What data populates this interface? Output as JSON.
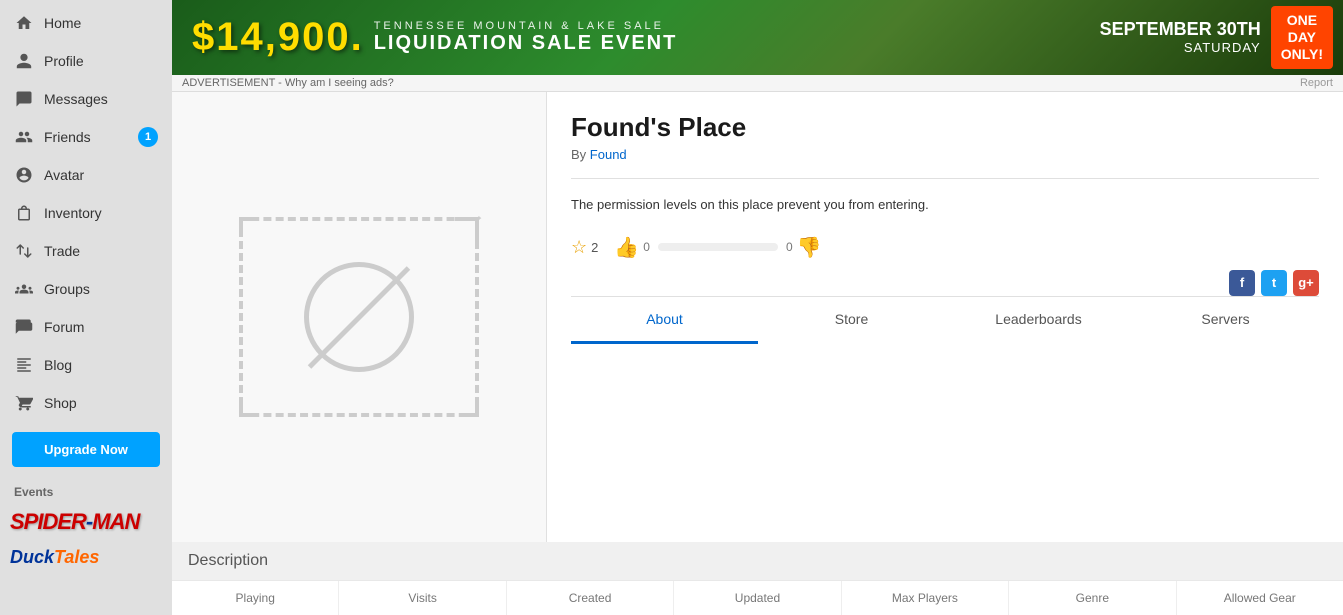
{
  "sidebar": {
    "nav_items": [
      {
        "id": "home",
        "label": "Home",
        "icon": "home"
      },
      {
        "id": "profile",
        "label": "Profile",
        "icon": "person"
      },
      {
        "id": "messages",
        "label": "Messages",
        "icon": "message"
      },
      {
        "id": "friends",
        "label": "Friends",
        "icon": "friends",
        "badge": "1"
      },
      {
        "id": "avatar",
        "label": "Avatar",
        "icon": "avatar"
      },
      {
        "id": "inventory",
        "label": "Inventory",
        "icon": "bag"
      },
      {
        "id": "trade",
        "label": "Trade",
        "icon": "trade"
      },
      {
        "id": "groups",
        "label": "Groups",
        "icon": "groups"
      },
      {
        "id": "forum",
        "label": "Forum",
        "icon": "forum"
      },
      {
        "id": "blog",
        "label": "Blog",
        "icon": "blog"
      },
      {
        "id": "shop",
        "label": "Shop",
        "icon": "shop"
      }
    ],
    "upgrade_label": "Upgrade Now",
    "events_label": "Events"
  },
  "ad": {
    "price": "$14,900.",
    "line1": "TENNESSEE MOUNTAIN & LAKE SALE",
    "line2": "LIQUIDATION SALE EVENT",
    "date_line1": "SEPTEMBER 30TH",
    "date_day": "SATURDAY",
    "one_day_line1": "ONE",
    "one_day_line2": "DAY",
    "one_day_line3": "ONLY!",
    "footer_text": "ADVERTISEMENT - Why am I seeing ads?",
    "report_label": "Report"
  },
  "place": {
    "title": "Found's Place",
    "by_label": "By",
    "author": "Found",
    "permission_text": "The permission levels on this place prevent you from entering.",
    "star_count": "2",
    "thumb_up_count": "0",
    "thumb_down_count": "0"
  },
  "tabs": [
    {
      "id": "about",
      "label": "About",
      "active": true
    },
    {
      "id": "store",
      "label": "Store",
      "active": false
    },
    {
      "id": "leaderboards",
      "label": "Leaderboards",
      "active": false
    },
    {
      "id": "servers",
      "label": "Servers",
      "active": false
    }
  ],
  "description_label": "Description",
  "stats": {
    "headers": [
      "Playing",
      "Visits",
      "Created",
      "Updated",
      "Max Players",
      "Genre",
      "Allowed Gear"
    ]
  },
  "social": {
    "fb": "f",
    "tw": "t",
    "gp": "g+"
  }
}
